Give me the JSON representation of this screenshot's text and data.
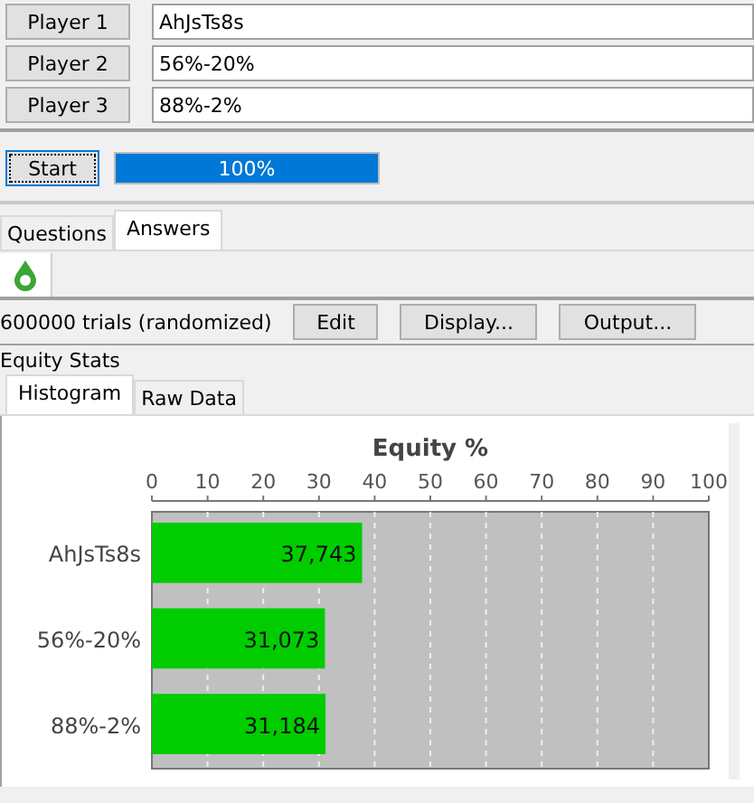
{
  "players": [
    {
      "label": "Player 1",
      "value": "AhJsTs8s"
    },
    {
      "label": "Player 2",
      "value": "56%-20%"
    },
    {
      "label": "Player 3",
      "value": "88%-2%"
    }
  ],
  "start_button": "Start",
  "progress": {
    "level": 1,
    "text": "100%"
  },
  "tabs": [
    {
      "label": "Questions",
      "selected": false
    },
    {
      "label": "Answers",
      "selected": true
    }
  ],
  "trials": "600000 trials (randomized)",
  "buttons": [
    "Edit",
    "Display...",
    "Output..."
  ],
  "section_title": "Equity Stats",
  "sub_tabs": [
    {
      "label": "Histogram",
      "selected": true
    },
    {
      "label": "Raw Data",
      "selected": false
    }
  ],
  "chart_data": {
    "type": "bar",
    "orientation": "horizontal",
    "title": "Equity %",
    "categories": [
      "AhJsTs8s",
      "56%-20%",
      "88%-2%"
    ],
    "series": [
      {
        "color": "#00cc00",
        "values": [
          37.743,
          31.073,
          31.184
        ]
      }
    ],
    "grid": true,
    "xlim": [
      0,
      100
    ],
    "xticks": [
      0,
      10,
      20,
      30,
      40,
      50,
      60,
      70,
      80,
      90,
      100
    ],
    "value_labels": [
      "37,743",
      "31,073",
      "31,184"
    ]
  }
}
